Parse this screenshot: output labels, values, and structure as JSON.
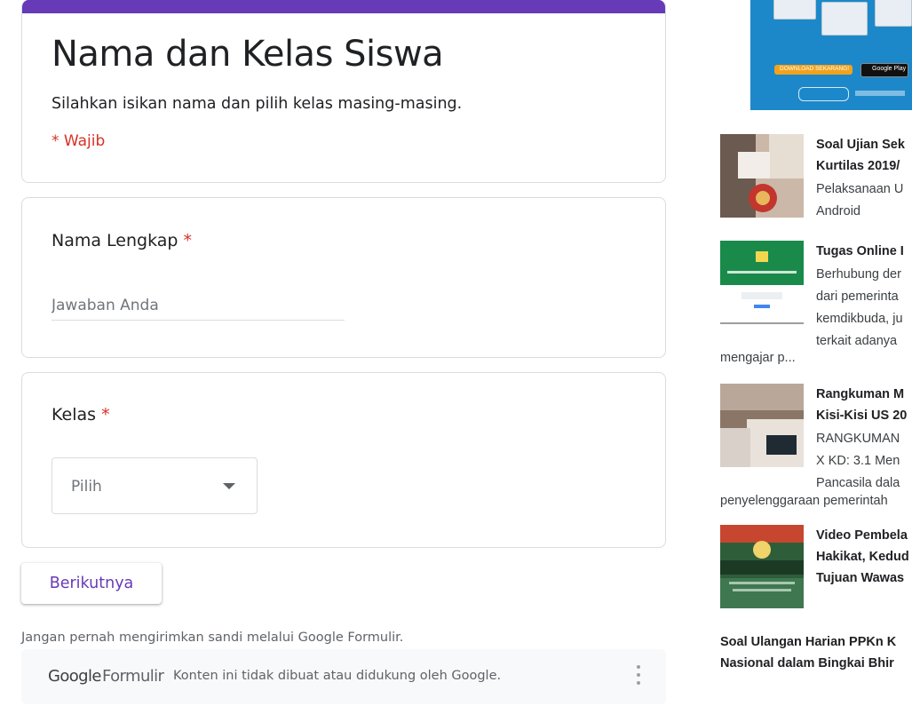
{
  "form": {
    "title": "Nama dan Kelas Siswa",
    "description": "Silahkan isikan nama dan pilih kelas masing-masing.",
    "required_note": "* Wajib",
    "accent_color": "#673ab7",
    "required_color": "#d93025",
    "questions": [
      {
        "label": "Nama Lengkap",
        "required_mark": "*",
        "placeholder": "Jawaban Anda"
      },
      {
        "label": "Kelas",
        "required_mark": "*",
        "selected": "Pilih"
      }
    ],
    "next_button": "Berikutnya",
    "warning": "Jangan pernah mengirimkan sandi melalui Google Formulir.",
    "footer": {
      "brand_google": "Google",
      "brand_forms": "Formulir",
      "disclaimer": "Konten ini tidak dibuat atau didukung oleh Google.",
      "more_icon": "more-vert-icon"
    }
  },
  "sidebar": {
    "banner": {
      "download_label": "DOWNLOAD SEKARANG!",
      "store_label": "Google Play"
    },
    "posts": [
      {
        "title_lines": [
          "Soal Ujian Sek",
          "Kurtilas 2019/"
        ],
        "snippet_lines": [
          "Pelaksanaan U",
          "Android"
        ],
        "tail": ""
      },
      {
        "title_lines": [
          "Tugas Online I"
        ],
        "snippet_lines": [
          "Berhubung der",
          "dari pemerinta",
          "kemdikbuda, ju",
          "terkait adanya"
        ],
        "tail": "mengajar p..."
      },
      {
        "title_lines": [
          "Rangkuman M",
          "Kisi-Kisi US 20"
        ],
        "snippet_lines": [
          "RANGKUMAN",
          "X KD: 3.1 Men",
          "Pancasila dala"
        ],
        "tail": "penyelenggaraan pemerintah"
      },
      {
        "title_lines": [
          "Video Pembela",
          "Hakikat, Kedud",
          "Tujuan Wawas"
        ],
        "snippet_lines": [],
        "tail": ""
      }
    ],
    "bottom_post_lines": [
      "Soal Ulangan Harian PPKn K",
      "Nasional dalam Bingkai Bhir"
    ]
  }
}
